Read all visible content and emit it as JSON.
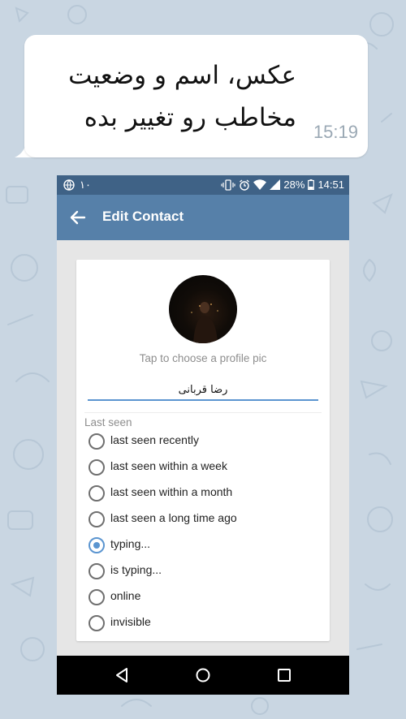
{
  "message": {
    "text": "عکس، اسم و وضعیت مخاطب رو تغییر بده",
    "time": "15:19"
  },
  "status_bar": {
    "left_number": "۱۰",
    "battery": "28%",
    "clock": "14:51"
  },
  "app_bar": {
    "title": "Edit Contact",
    "back_icon": "arrow-back-icon"
  },
  "profile": {
    "hint": "Tap to choose a profile pic",
    "name_value": "رضا قربانی"
  },
  "last_seen": {
    "label": "Last seen",
    "selected_index": 4,
    "options": [
      "last seen recently",
      "last seen within a week",
      "last seen within a month",
      "last seen a long time ago",
      "typing...",
      "is typing...",
      "online",
      "invisible"
    ]
  },
  "nav_bar": {
    "icons": [
      "back-triangle-icon",
      "home-circle-icon",
      "recents-square-icon"
    ]
  },
  "colors": {
    "background": "#c9d6e2",
    "status_bar": "#3f6286",
    "app_bar": "#5680a9",
    "accent": "#5b95d0"
  }
}
